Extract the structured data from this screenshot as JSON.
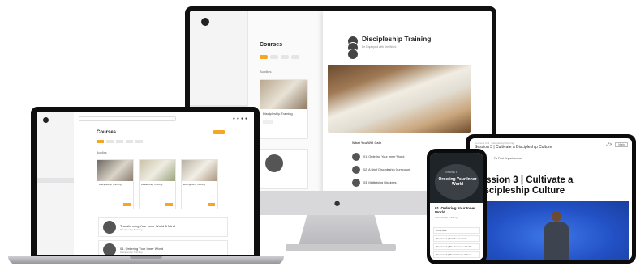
{
  "imac": {
    "courses_title": "Courses",
    "bundles_label": "Bundles",
    "card_title": "Discipleship Training",
    "panel": {
      "title": "Discipleship Training",
      "subtitle": "Be Equipped with the Word",
      "learn_heading": "What You Will Gain",
      "items": [
        "01. Ordering Your Inner World",
        "02. A Brief Discipleship Curriculum",
        "03. Multiplying Disciples"
      ]
    }
  },
  "laptop": {
    "courses_title": "Courses",
    "bundles_label": "Bundles",
    "cards": [
      "Discipleship Training",
      "Leadership Training",
      "Evangelism Training"
    ],
    "rows": [
      {
        "title": "Transforming Your Inner World & Mind",
        "sub": "Discipleship Training"
      },
      {
        "title": "01. Ordering Your Inner World",
        "sub": "Discipleship Training"
      }
    ]
  },
  "phone": {
    "course_label": "COURSE 1",
    "hero_title": "Ordering Your Inner World",
    "title": "01. Ordering Your Inner World",
    "subtitle": "Discipleship Training",
    "sections": [
      "Overview",
      "Session 1 | Set the Ground",
      "Session 2 | The Journey of Faith",
      "Session 3 | The Intimacy of God"
    ]
  },
  "tablet": {
    "header_top": "Course 1 of 3 · Discipleship Training",
    "header_title": "Session 3 | Cultivate a Discipleship Culture",
    "author": "Ps Paul Jeyachandran",
    "mark_label": "Mark",
    "title": "Session 3 | Cultivate a Discipleship Culture"
  }
}
